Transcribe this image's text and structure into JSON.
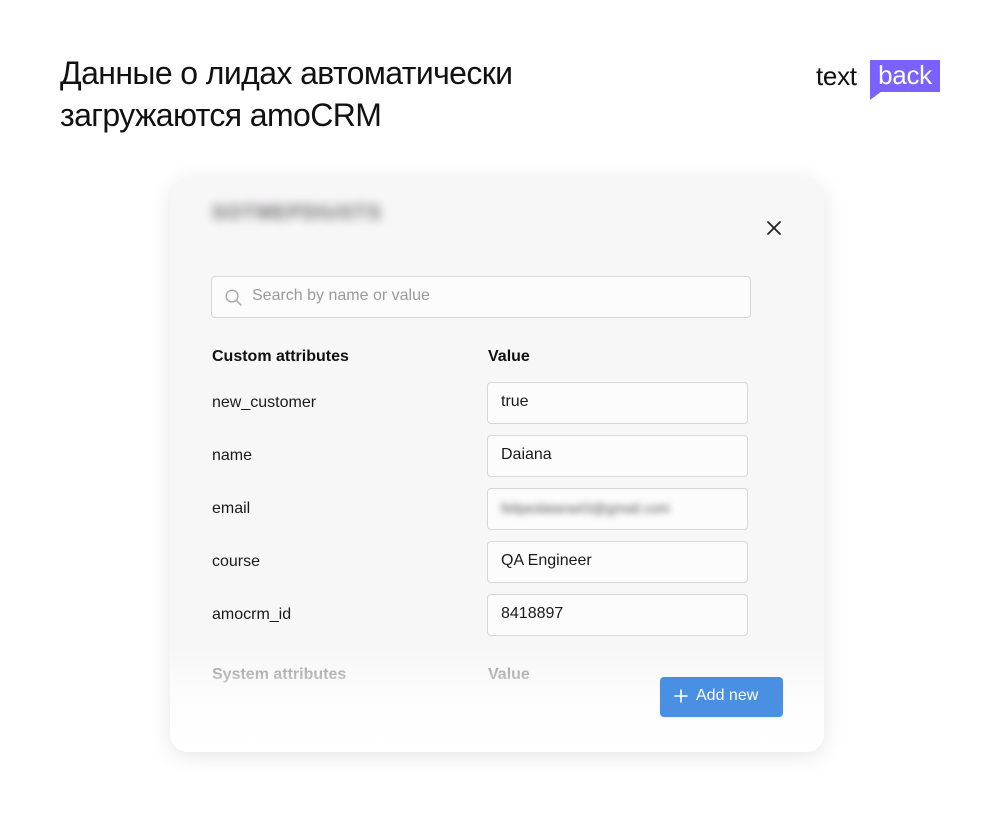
{
  "headline": {
    "line1": "Данные о лидах автоматически",
    "line2": "загружаются amoCRM"
  },
  "logo": {
    "text": "text",
    "badge": "back",
    "accent_color": "#7b61ff"
  },
  "dialog": {
    "title": "SOTMEPDIUSTS",
    "close_icon": "close-icon",
    "search": {
      "placeholder": "Search by name or value",
      "value": "",
      "icon": "search-icon"
    },
    "custom_attributes": {
      "header_name": "Custom attributes",
      "header_value": "Value",
      "rows": [
        {
          "name": "new_customer",
          "value": "true"
        },
        {
          "name": "name",
          "value": "Daiana"
        },
        {
          "name": "email",
          "value": "felipedaiana43@gmail.com"
        },
        {
          "name": "course",
          "value": "QA Engineer"
        },
        {
          "name": "amocrm_id",
          "value": "8418897"
        }
      ]
    },
    "system_attributes": {
      "header_name": "System attributes",
      "header_value": "Value"
    },
    "add_button": {
      "label": "Add new",
      "icon": "plus-icon",
      "color": "#4a90e2"
    }
  }
}
